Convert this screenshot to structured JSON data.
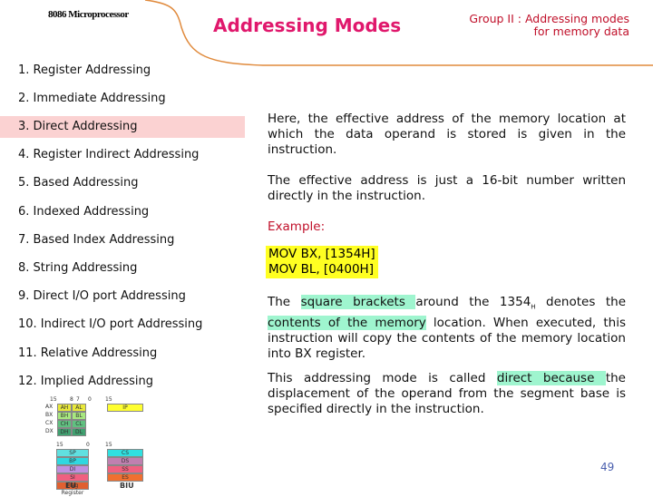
{
  "header": {
    "subject": "8086 Microprocessor",
    "title": "Addressing Modes",
    "group_line1": "Group II : Addressing modes",
    "group_line2": "for memory data"
  },
  "menu": [
    "1.  Register Addressing",
    "2.  Immediate Addressing",
    "3.  Direct Addressing",
    "4.  Register Indirect Addressing",
    "5.  Based Addressing",
    "6.  Indexed Addressing",
    "7.  Based Index Addressing",
    "8.  String Addressing",
    "9.  Direct I/O port Addressing",
    "10. Indirect I/O port Addressing",
    "11. Relative Addressing",
    "12. Implied Addressing"
  ],
  "selected_item": "3.  Direct Addressing",
  "content": {
    "p1": "Here, the effective address of the memory location at which the data operand is stored is given in the instruction.",
    "p2": "The effective address is just a 16-bit number written directly in the instruction.",
    "example": "Example:",
    "code1": "MOV  BX, [1354H]",
    "code2": "MOV  BL, [0400H]",
    "p3a": "The ",
    "p3b": "square brackets ",
    "p3c": "around the  1354",
    "p3sub": "H",
    "p3d": " denotes the ",
    "p3e": "contents of the memory",
    "p3f": " location. When executed, this instruction will copy the contents of the memory location into BX register.",
    "p4a": "This addressing mode is called ",
    "p4b": "direct because ",
    "p4c": "the displacement of the operand from the segment base is specified directly in the instruction."
  },
  "diagram": {
    "eu": "EU",
    "biu": "BIU",
    "gp": [
      [
        "AX",
        "AH",
        "AL"
      ],
      [
        "BX",
        "BH",
        "BL"
      ],
      [
        "CX",
        "CH",
        "CL"
      ],
      [
        "DX",
        "DH",
        "DL"
      ]
    ],
    "ptr": [
      "SP",
      "BP",
      "DI",
      "SI",
      "Flag Register"
    ],
    "ip": "IP",
    "seg": [
      "CS",
      "DS",
      "SS",
      "ES"
    ],
    "b15": "15",
    "b8": "8",
    "b7": "7",
    "b0": "0"
  },
  "page_number": "49",
  "colors": {
    "title": "#e0186c",
    "selected": "#fbd2d2",
    "highlight": "#9ff5cf",
    "code_bg": "#ffff22"
  }
}
